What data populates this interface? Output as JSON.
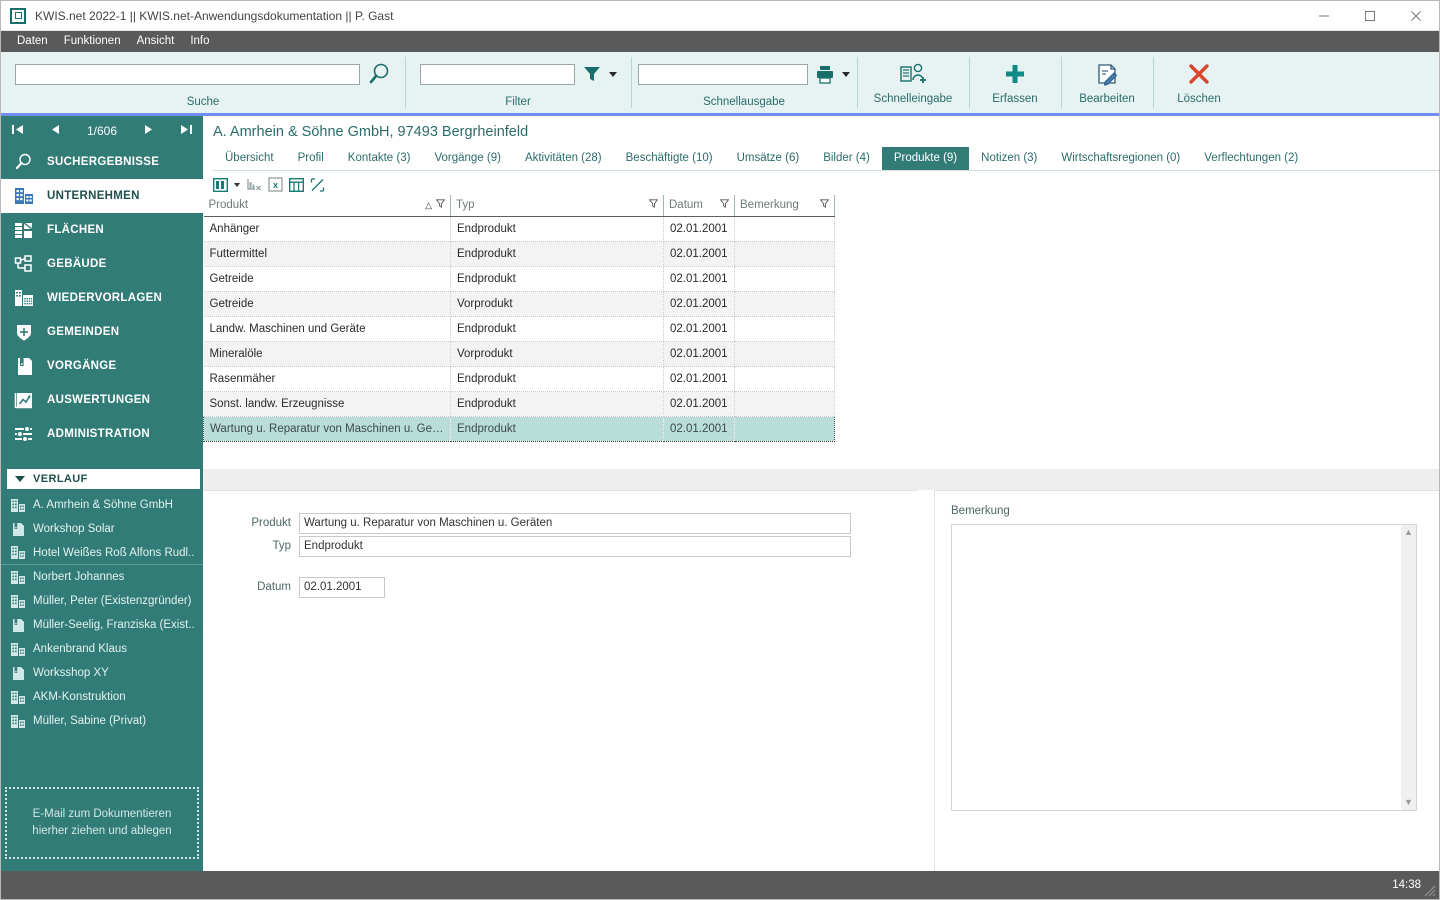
{
  "window": {
    "title": "KWIS.net 2022-1 || KWIS.net-Anwendungsdokumentation || P. Gast",
    "minimize_label": "–",
    "maximize_label": "□",
    "close_label": "✕"
  },
  "menubar": {
    "items": [
      {
        "label": "Daten"
      },
      {
        "label": "Funktionen"
      },
      {
        "label": "Ansicht"
      },
      {
        "label": "Info"
      }
    ]
  },
  "ribbon": {
    "groups": [
      {
        "label": "Suche",
        "input_value": "",
        "icon": "magnifier-icon"
      },
      {
        "label": "Filter",
        "input_value": "",
        "icon": "funnel-icon"
      },
      {
        "label": "Schnellausgabe",
        "input_value": "",
        "icon": "printer-icon"
      }
    ],
    "buttons": [
      {
        "label": "Schnelleingabe",
        "icon": "quick-entry-icon"
      },
      {
        "label": "Erfassen",
        "icon": "plus-icon"
      },
      {
        "label": "Bearbeiten",
        "icon": "edit-pencil-icon"
      },
      {
        "label": "Löschen",
        "icon": "x-delete-icon"
      }
    ]
  },
  "sidebar": {
    "pager": {
      "first": "❘◀",
      "prev": "◀",
      "count": "1/606",
      "next": "▶",
      "last": "▶❘"
    },
    "nav": [
      {
        "label": "SUCHERGEBNISSE",
        "icon": "magnifier-icon",
        "active": false
      },
      {
        "label": "UNTERNEHMEN",
        "icon": "building-icon",
        "active": true
      },
      {
        "label": "FLÄCHEN",
        "icon": "layers-icon",
        "active": false
      },
      {
        "label": "GEBÄUDE",
        "icon": "blocks-icon",
        "active": false
      },
      {
        "label": "WIEDERVORLAGEN",
        "icon": "calendar-building-icon",
        "active": false
      },
      {
        "label": "GEMEINDEN",
        "icon": "shield-icon",
        "active": false
      },
      {
        "label": "VORGÄNGE",
        "icon": "binder-icon",
        "active": false
      },
      {
        "label": "AUSWERTUNGEN",
        "icon": "chart-icon",
        "active": false
      },
      {
        "label": "ADMINISTRATION",
        "icon": "sliders-icon",
        "active": false
      }
    ],
    "verlauf": {
      "header": "VERLAUF",
      "items": [
        {
          "label": "A. Amrhein & Söhne GmbH",
          "icon": "building-icon"
        },
        {
          "label": "Workshop Solar",
          "icon": "binder-icon"
        },
        {
          "label": "Hotel Weißes Roß Alfons Rudl..",
          "icon": "building-icon"
        },
        {
          "label": "Norbert Johannes",
          "icon": "building-icon"
        },
        {
          "label": "Müller, Peter (Existenzgründer)",
          "icon": "building-icon"
        },
        {
          "label": "Müller-Seelig, Franziska (Exist..",
          "icon": "binder-icon"
        },
        {
          "label": "Ankenbrand Klaus",
          "icon": "building-icon"
        },
        {
          "label": "Worksshop XY",
          "icon": "binder-icon"
        },
        {
          "label": "AKM-Konstruktion",
          "icon": "building-icon"
        },
        {
          "label": "Müller, Sabine (Privat)",
          "icon": "building-icon"
        }
      ]
    },
    "dropzone": {
      "line1": "E-Mail  zum Dokumentieren",
      "line2": "hierher ziehen und ablegen"
    }
  },
  "main": {
    "record_title": "A. Amrhein & Söhne GmbH, 97493 Bergrheinfeld",
    "tabs": [
      {
        "label": "Übersicht",
        "active": false
      },
      {
        "label": "Profil",
        "active": false
      },
      {
        "label": "Kontakte (3)",
        "active": false
      },
      {
        "label": "Vorgänge (9)",
        "active": false
      },
      {
        "label": "Aktivitäten (28)",
        "active": false
      },
      {
        "label": "Beschäftigte (10)",
        "active": false
      },
      {
        "label": "Umsätze (6)",
        "active": false
      },
      {
        "label": "Bilder (4)",
        "active": false
      },
      {
        "label": "Produkte (9)",
        "active": true
      },
      {
        "label": "Notizen (3)",
        "active": false
      },
      {
        "label": "Wirtschaftsregionen (0)",
        "active": false
      },
      {
        "label": "Verflechtungen (2)",
        "active": false
      }
    ],
    "grid_toolbar": [
      {
        "icon": "columns-icon"
      },
      {
        "icon": "chevron-down-icon"
      },
      {
        "icon": "clear-sort-icon"
      },
      {
        "icon": "excel-export-icon"
      },
      {
        "icon": "table-layout-icon"
      },
      {
        "icon": "expand-icon"
      }
    ]
  },
  "table": {
    "columns": [
      {
        "label": "Produkt",
        "sorted": "asc",
        "filter": true
      },
      {
        "label": "Typ",
        "sorted": "",
        "filter": true
      },
      {
        "label": "Datum",
        "sorted": "",
        "filter": true
      },
      {
        "label": "Bemerkung",
        "sorted": "",
        "filter": true
      }
    ],
    "rows": [
      {
        "produkt": "Anhänger",
        "typ": "Endprodukt",
        "datum": "02.01.2001",
        "bemerkung": "",
        "selected": false
      },
      {
        "produkt": "Futtermittel",
        "typ": "Endprodukt",
        "datum": "02.01.2001",
        "bemerkung": "",
        "selected": false
      },
      {
        "produkt": "Getreide",
        "typ": "Endprodukt",
        "datum": "02.01.2001",
        "bemerkung": "",
        "selected": false
      },
      {
        "produkt": "Getreide",
        "typ": "Vorprodukt",
        "datum": "02.01.2001",
        "bemerkung": "",
        "selected": false
      },
      {
        "produkt": "Landw. Maschinen und Geräte",
        "typ": "Endprodukt",
        "datum": "02.01.2001",
        "bemerkung": "",
        "selected": false
      },
      {
        "produkt": "Mineralöle",
        "typ": "Vorprodukt",
        "datum": "02.01.2001",
        "bemerkung": "",
        "selected": false
      },
      {
        "produkt": "Rasenmäher",
        "typ": "Endprodukt",
        "datum": "02.01.2001",
        "bemerkung": "",
        "selected": false
      },
      {
        "produkt": "Sonst. landw. Erzeugnisse",
        "typ": "Endprodukt",
        "datum": "02.01.2001",
        "bemerkung": "",
        "selected": false
      },
      {
        "produkt": "Wartung u. Reparatur von Maschinen u. Gerä..",
        "typ": "Endprodukt",
        "datum": "02.01.2001",
        "bemerkung": "",
        "selected": true
      }
    ]
  },
  "detail": {
    "produkt_label": "Produkt",
    "produkt_value": "Wartung u. Reparatur von Maschinen u. Geräten",
    "typ_label": "Typ",
    "typ_value": "Endprodukt",
    "datum_label": "Datum",
    "datum_value": "02.01.2001",
    "bemerkung_label": "Bemerkung",
    "bemerkung_value": ""
  },
  "statusbar": {
    "time": "14:38"
  },
  "colors": {
    "teal": "#327c78",
    "teal_dark": "#2b6c6a",
    "ribbon_bg": "#e6f3f2",
    "menubar": "#5a5a5a",
    "accent_blue": "#6f8ef0",
    "selection": "#b9ddd8",
    "delete_red": "#d9452a"
  }
}
